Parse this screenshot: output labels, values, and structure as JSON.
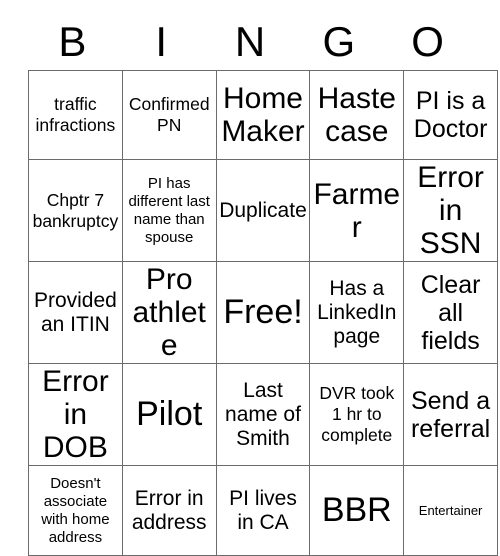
{
  "card": {
    "header_letters": [
      "B",
      "I",
      "N",
      "G",
      "O"
    ],
    "rows": [
      [
        {
          "text": "traffic infractions",
          "size": "sz-m"
        },
        {
          "text": "Confirmed PN",
          "size": "sz-m"
        },
        {
          "text": "Home Maker",
          "size": "sz-xxl"
        },
        {
          "text": "Haste case",
          "size": "sz-xxl"
        },
        {
          "text": "PI is a Doctor",
          "size": "sz-xl"
        }
      ],
      [
        {
          "text": "Chptr 7 bankruptcy",
          "size": "sz-m"
        },
        {
          "text": "PI has different last name than spouse",
          "size": "sz-s"
        },
        {
          "text": "Duplicate",
          "size": "sz-l"
        },
        {
          "text": "Farmer",
          "size": "sz-xxl"
        },
        {
          "text": "Error in SSN",
          "size": "sz-xxl"
        }
      ],
      [
        {
          "text": "Provided an ITIN",
          "size": "sz-l"
        },
        {
          "text": "Pro athlete",
          "size": "sz-xxl"
        },
        {
          "text": "Free!",
          "size": "sz-huge"
        },
        {
          "text": "Has a LinkedIn page",
          "size": "sz-l"
        },
        {
          "text": "Clear all fields",
          "size": "sz-xl"
        }
      ],
      [
        {
          "text": "Error in DOB",
          "size": "sz-xxl"
        },
        {
          "text": "Pilot",
          "size": "sz-huge"
        },
        {
          "text": "Last name of Smith",
          "size": "sz-l"
        },
        {
          "text": "DVR took 1 hr to complete",
          "size": "sz-m"
        },
        {
          "text": "Send a referral",
          "size": "sz-xl"
        }
      ],
      [
        {
          "text": "Doesn't associate with home address",
          "size": "sz-s"
        },
        {
          "text": "Error in address",
          "size": "sz-l"
        },
        {
          "text": "PI lives in CA",
          "size": "sz-l"
        },
        {
          "text": "BBR",
          "size": "sz-huge"
        },
        {
          "text": "Entertainer",
          "size": "sz-xs"
        }
      ]
    ],
    "free_space": {
      "row": 2,
      "col": 2
    }
  }
}
